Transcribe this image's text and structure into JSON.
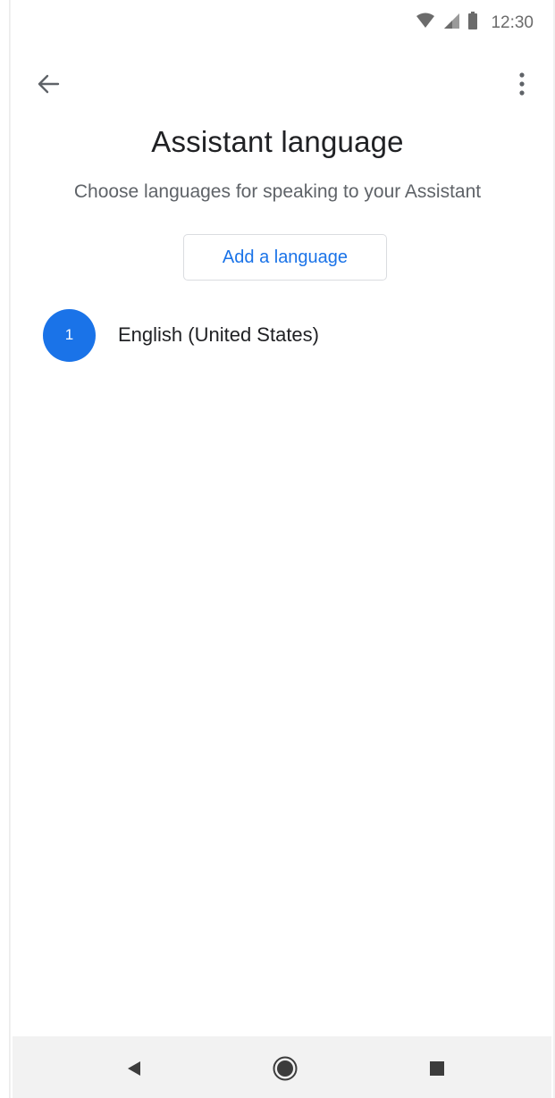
{
  "status_bar": {
    "time": "12:30",
    "icons": [
      "wifi-icon",
      "signal-icon",
      "battery-icon"
    ]
  },
  "app_bar": {
    "back_icon": "arrow-back-icon",
    "menu_icon": "more-vert-icon"
  },
  "header": {
    "title": "Assistant language",
    "subtitle": "Choose languages for speaking to your Assistant"
  },
  "actions": {
    "add_language_label": "Add a language"
  },
  "languages": [
    {
      "rank": "1",
      "name": "English (United States)"
    }
  ],
  "nav_bar": {
    "icons": [
      "back-triangle-icon",
      "home-circle-icon",
      "recents-square-icon"
    ]
  },
  "colors": {
    "accent": "#1a73e8",
    "title_text": "#202124",
    "secondary_text": "#5f6368",
    "nav_bar_bg": "#f2f2f2"
  }
}
